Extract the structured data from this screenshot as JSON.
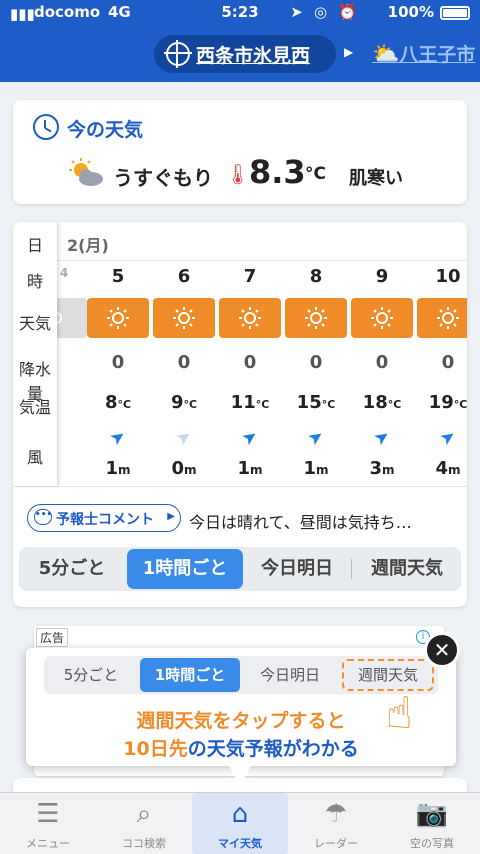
{
  "status": {
    "carrier": "docomo",
    "network": "4G",
    "time": "5:23",
    "battery": "100%"
  },
  "header": {
    "location": "西条市氷見西",
    "next_location": "八王子市"
  },
  "now": {
    "title": "今の天気",
    "condition": "うすぐもり",
    "temp": "8.3",
    "unit": "°C",
    "feel": "肌寒い"
  },
  "forecast": {
    "side_labels": [
      "日",
      "時",
      "天気",
      "降水量",
      "気温",
      "風"
    ],
    "date": "2(月)",
    "hours": [
      {
        "hour": "5",
        "rain": "0",
        "temp": "8",
        "wind": "1"
      },
      {
        "hour": "6",
        "rain": "0",
        "temp": "9",
        "wind": "0"
      },
      {
        "hour": "7",
        "rain": "0",
        "temp": "11",
        "wind": "1"
      },
      {
        "hour": "8",
        "rain": "0",
        "temp": "15",
        "wind": "1"
      },
      {
        "hour": "9",
        "rain": "0",
        "temp": "18",
        "wind": "3"
      },
      {
        "hour": "10",
        "rain": "0",
        "temp": "19",
        "wind": "4"
      }
    ],
    "temp_unit": "°C",
    "wind_unit": "m",
    "comment_button": "予報士コメント",
    "comment_text": "今日は晴れて、昼間は気持ち…",
    "segments": [
      "5分ごと",
      "1時間ごと",
      "今日明日",
      "週間天気"
    ]
  },
  "tooltip": {
    "segments": [
      "5分ごと",
      "1時間ごと",
      "今日明日",
      "週間天気"
    ],
    "line1": "週間天気をタップすると",
    "line2_a": "10日先",
    "line2_b": "の天気予報がわかる"
  },
  "ad": {
    "tag": "広告"
  },
  "tabs": [
    {
      "label": "メニュー",
      "icon": "menu-icon"
    },
    {
      "label": "ココ検索",
      "icon": "search-icon"
    },
    {
      "label": "マイ天気",
      "icon": "home-icon"
    },
    {
      "label": "レーダー",
      "icon": "umbrella-icon"
    },
    {
      "label": "空の写真",
      "icon": "camera-icon"
    }
  ],
  "colors": {
    "header": "#1e5cc8",
    "accent_orange": "#f08b2a",
    "active_tab": "#3a8be8"
  }
}
